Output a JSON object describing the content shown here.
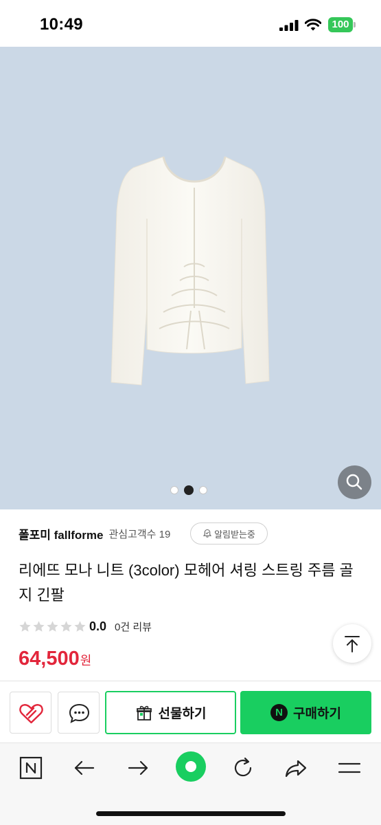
{
  "status_bar": {
    "time": "10:49",
    "battery_level": "100",
    "icons": [
      "signal-icon",
      "wifi-icon",
      "battery-icon"
    ]
  },
  "gallery": {
    "page_count": 3,
    "active_index": 1,
    "background_color": "#cbd8e6",
    "zoom_icon": "search-icon"
  },
  "seller": {
    "name": "폴포미 fallforme",
    "follower_text": "관심고객수 19",
    "notify_label": "알림받는중"
  },
  "product": {
    "title": "리에뜨 모나 니트 (3color) 모헤어 셔링 스트링 주름 골지 긴팔",
    "rating": "0.0",
    "review_count": "0건 리뷰",
    "stars_filled": 0,
    "stars_total": 5,
    "price": "64,500",
    "price_unit": "원",
    "price_color": "#e2263b"
  },
  "actions": {
    "gift_label": "선물하기",
    "buy_label": "구매하기",
    "npay_badge": "N",
    "accent_color": "#19ce60"
  },
  "toolbar": {
    "icons": [
      "naver-n-icon",
      "back-arrow-icon",
      "forward-arrow-icon",
      "home-circle-icon",
      "refresh-icon",
      "share-icon",
      "menu-icon"
    ]
  }
}
